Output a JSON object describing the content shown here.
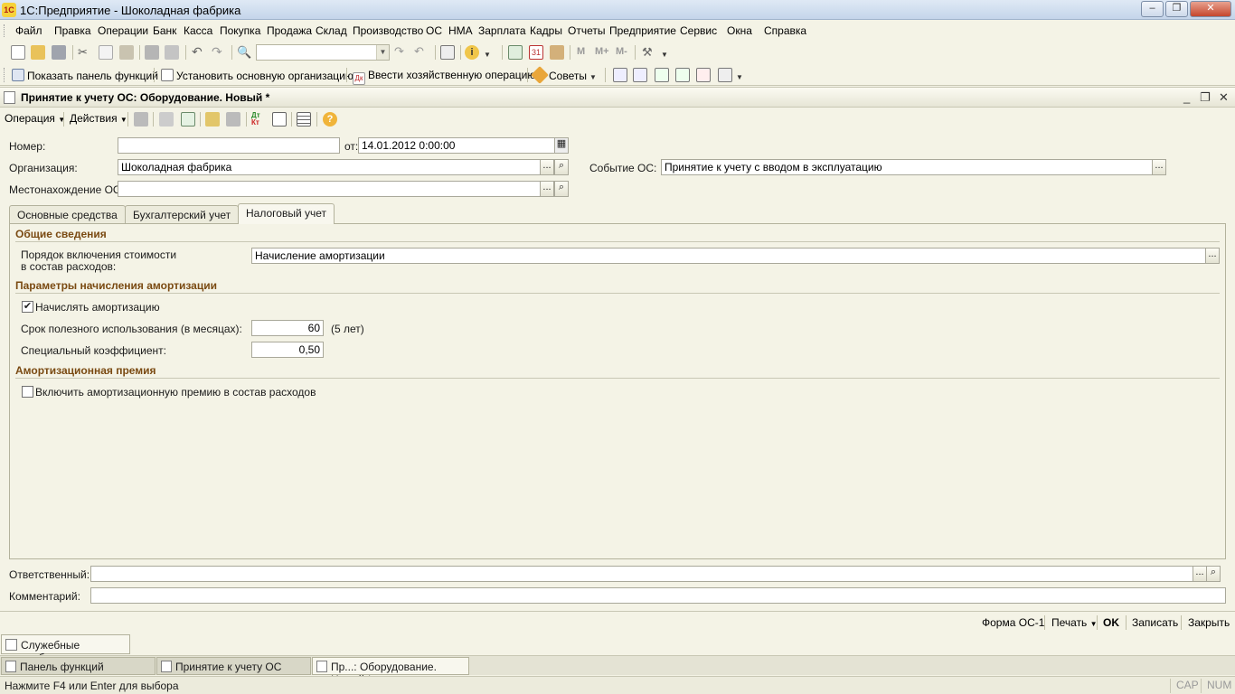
{
  "app": {
    "title": "1С:Предприятие - Шоколадная фабрика",
    "icon_text": "1С"
  },
  "menu": [
    "Файл",
    "Правка",
    "Операции",
    "Банк",
    "Касса",
    "Покупка",
    "Продажа",
    "Склад",
    "Производство",
    "ОС",
    "НМА",
    "Зарплата",
    "Кадры",
    "Отчеты",
    "Предприятие",
    "Сервис",
    "Окна",
    "Справка"
  ],
  "toolbar1": {
    "m_labels": [
      "M",
      "M+",
      "M-"
    ]
  },
  "toolbar2": {
    "show_panel": "Показать панель функций",
    "set_org": "Установить основную организацию",
    "enter_op": "Ввести хозяйственную операцию",
    "tips": "Советы"
  },
  "document": {
    "title": "Принятие к учету ОС: Оборудование. Новый *",
    "toolbar": {
      "operation": "Операция",
      "actions": "Действия"
    },
    "fields": {
      "number_label": "Номер:",
      "number_value": "",
      "date_label": "от:",
      "date_value": "14.01.2012  0:00:00",
      "org_label": "Организация:",
      "org_value": "Шоколадная фабрика",
      "event_label": "Событие ОС:",
      "event_value": "Принятие к учету с вводом в эксплуатацию",
      "location_label": "Местонахождение ОС:",
      "location_value": ""
    },
    "tabs": [
      "Основные средства",
      "Бухгалтерский учет",
      "Налоговый учет"
    ],
    "active_tab": "Налоговый учет",
    "tax": {
      "general_title": "Общие сведения",
      "cost_order_label_1": "Порядок включения стоимости",
      "cost_order_label_2": "в состав расходов:",
      "cost_order_value": "Начисление амортизации",
      "params_title": "Параметры начисления амортизации",
      "accrue_label": "Начислять амортизацию",
      "accrue_checked": true,
      "useful_life_label": "Срок полезного использования (в месяцах):",
      "useful_life_value": "60",
      "useful_life_years": "(5 лет)",
      "coef_label": "Специальный коэффициент:",
      "coef_value": "0,50",
      "premium_title": "Амортизационная премия",
      "premium_label": "Включить амортизационную премию в состав расходов",
      "premium_checked": false
    },
    "responsible_label": "Ответственный:",
    "responsible_value": "",
    "comment_label": "Комментарий:",
    "comment_value": "",
    "footer": {
      "form": "Форма ОС-1",
      "print": "Печать",
      "ok": "OK",
      "save": "Записать",
      "close": "Закрыть"
    }
  },
  "service_messages": "Служебные сообщения",
  "window_tabs": [
    "Панель функций",
    "Принятие к учету ОС",
    "Пр...: Оборудование. Новый *"
  ],
  "status": {
    "text": "Нажмите F4 или Enter для выбора",
    "cap": "CAP",
    "num": "NUM"
  }
}
